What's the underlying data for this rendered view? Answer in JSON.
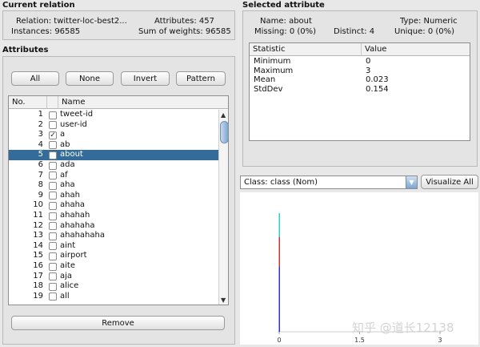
{
  "current_relation": {
    "title": "Current relation",
    "relation_label": "Relation:",
    "relation_value": "twitter-loc-best2...",
    "attributes_label": "Attributes:",
    "attributes_value": "457",
    "instances_label": "Instances:",
    "instances_value": "96585",
    "sum_weights_label": "Sum of weights:",
    "sum_weights_value": "96585"
  },
  "attributes_panel": {
    "title": "Attributes",
    "buttons": {
      "all": "All",
      "none": "None",
      "invert": "Invert",
      "pattern": "Pattern"
    },
    "columns": {
      "no": "No.",
      "name": "Name"
    },
    "rows": [
      {
        "no": "1",
        "name": "tweet-id",
        "checked": false
      },
      {
        "no": "2",
        "name": "user-id",
        "checked": false
      },
      {
        "no": "3",
        "name": "a",
        "checked": true
      },
      {
        "no": "4",
        "name": "ab",
        "checked": false
      },
      {
        "no": "5",
        "name": "about",
        "checked": false,
        "selected": true
      },
      {
        "no": "6",
        "name": "ada",
        "checked": false
      },
      {
        "no": "7",
        "name": "af",
        "checked": false
      },
      {
        "no": "8",
        "name": "aha",
        "checked": false
      },
      {
        "no": "9",
        "name": "ahah",
        "checked": false
      },
      {
        "no": "10",
        "name": "ahaha",
        "checked": false
      },
      {
        "no": "11",
        "name": "ahahah",
        "checked": false
      },
      {
        "no": "12",
        "name": "ahahaha",
        "checked": false
      },
      {
        "no": "13",
        "name": "ahahahaha",
        "checked": false
      },
      {
        "no": "14",
        "name": "aint",
        "checked": false
      },
      {
        "no": "15",
        "name": "airport",
        "checked": false
      },
      {
        "no": "16",
        "name": "aite",
        "checked": false
      },
      {
        "no": "17",
        "name": "aja",
        "checked": false
      },
      {
        "no": "18",
        "name": "alice",
        "checked": false
      },
      {
        "no": "19",
        "name": "all",
        "checked": false
      }
    ],
    "remove_label": "Remove"
  },
  "selected_attribute": {
    "title": "Selected attribute",
    "name_label": "Name:",
    "name_value": "about",
    "type_label": "Type:",
    "type_value": "Numeric",
    "missing_label": "Missing:",
    "missing_value": "0 (0%)",
    "distinct_label": "Distinct:",
    "distinct_value": "4",
    "unique_label": "Unique:",
    "unique_value": "0 (0%)",
    "stats_columns": {
      "statistic": "Statistic",
      "value": "Value"
    },
    "stats": [
      {
        "statistic": "Minimum",
        "value": "0"
      },
      {
        "statistic": "Maximum",
        "value": "3"
      },
      {
        "statistic": "Mean",
        "value": "0.023"
      },
      {
        "statistic": "StdDev",
        "value": "0.154"
      }
    ]
  },
  "class_selector": {
    "value": "Class: class (Nom)",
    "visualize_label": "Visualize All"
  },
  "histogram": {
    "x_ticks": [
      "0",
      "1.5",
      "3"
    ],
    "x_min": 0,
    "x_max": 3,
    "bars": [
      {
        "x": 0,
        "segments": [
          {
            "color": "#3333cc",
            "value": 0.55
          },
          {
            "color": "#cc3333",
            "value": 0.25
          },
          {
            "color": "#33cccc",
            "value": 0.2
          }
        ]
      }
    ]
  },
  "watermark": "知乎 @道长12138",
  "colors": {
    "selection": "#336c9b",
    "class_blue": "#3333cc",
    "class_red": "#cc3333",
    "class_cyan": "#33cccc"
  }
}
